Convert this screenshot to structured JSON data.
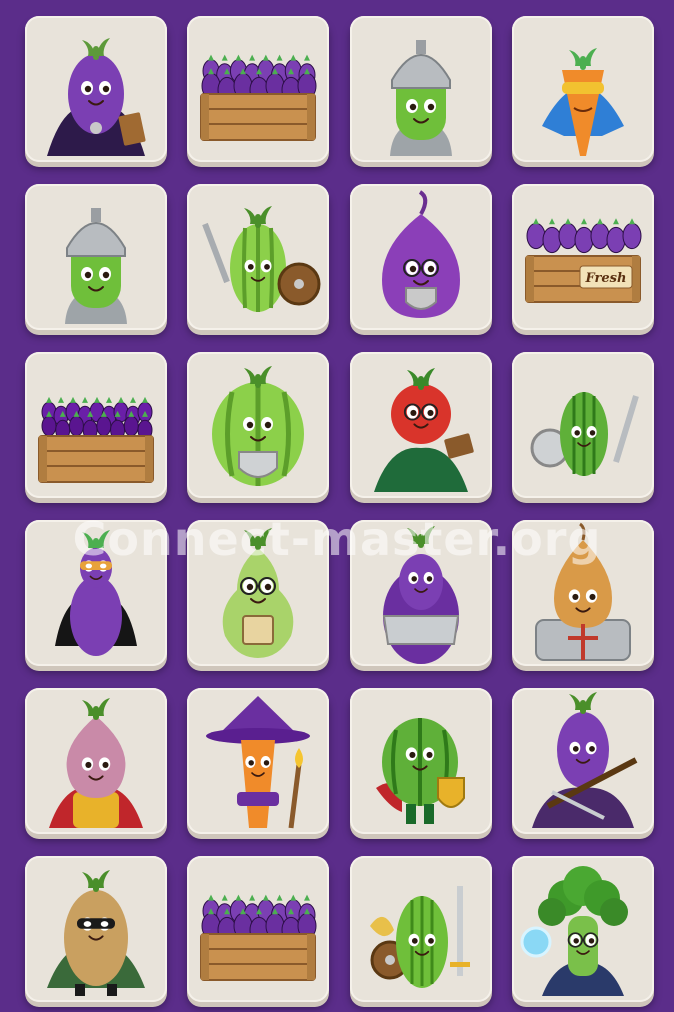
{
  "watermark": "Connect-master.org",
  "tiles": [
    {
      "icon": "eggplant-wizard-icon"
    },
    {
      "icon": "eggplant-crate-icon"
    },
    {
      "icon": "cucumber-knight-icon"
    },
    {
      "icon": "carrot-superhero-icon"
    },
    {
      "icon": "cucumber-knight-icon"
    },
    {
      "icon": "melon-warrior-icon"
    },
    {
      "icon": "onion-knight-icon"
    },
    {
      "icon": "eggplant-fresh-crate-icon"
    },
    {
      "icon": "grape-crate-icon"
    },
    {
      "icon": "melon-shield-icon"
    },
    {
      "icon": "tomato-wizard-icon"
    },
    {
      "icon": "watermelon-knight-icon"
    },
    {
      "icon": "eggplant-ninja-icon"
    },
    {
      "icon": "pear-scholar-icon"
    },
    {
      "icon": "eggplant-armor-icon"
    },
    {
      "icon": "onion-armor-icon"
    },
    {
      "icon": "onion-superhero-icon"
    },
    {
      "icon": "carrot-wizard-icon"
    },
    {
      "icon": "watermelon-shield-icon"
    },
    {
      "icon": "eggplant-samurai-icon"
    },
    {
      "icon": "potato-hero-icon"
    },
    {
      "icon": "eggplant-crate-icon"
    },
    {
      "icon": "cucumber-warrior-icon"
    },
    {
      "icon": "broccoli-mage-icon"
    }
  ],
  "crate_label": "Fresh"
}
